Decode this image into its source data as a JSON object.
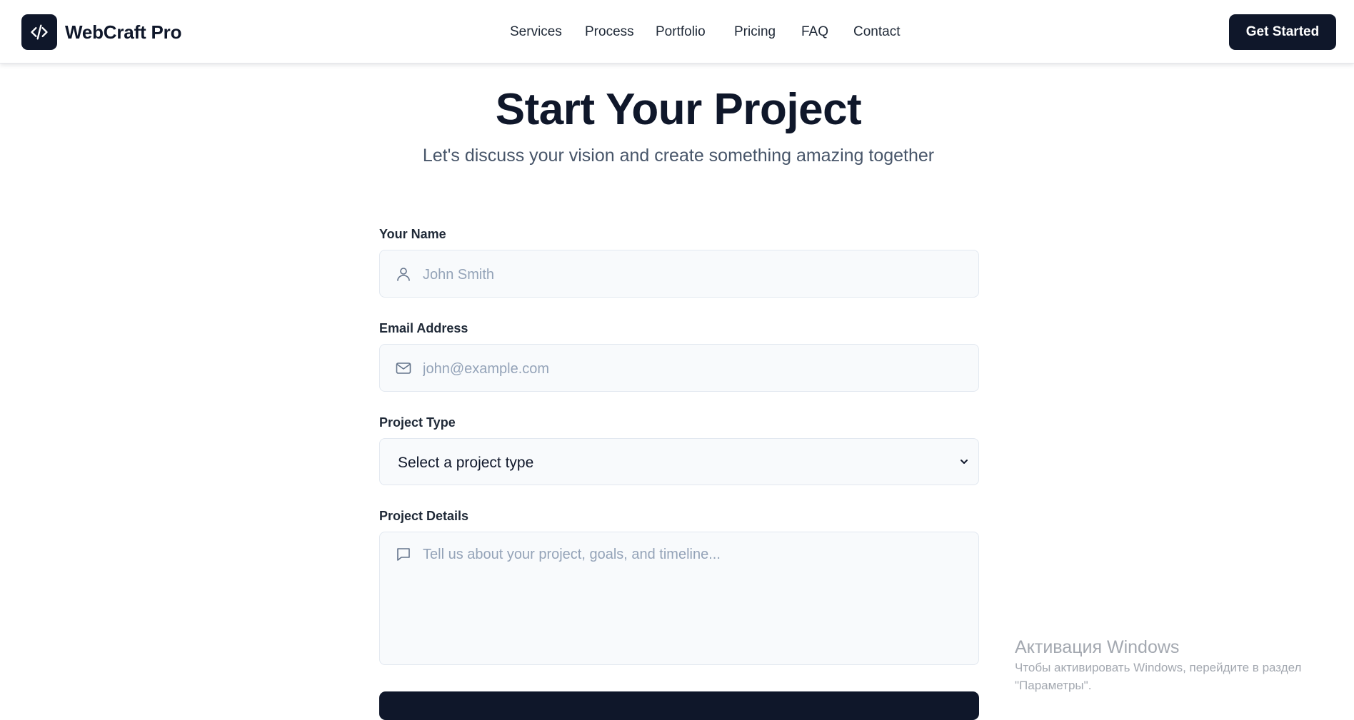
{
  "header": {
    "brand": "WebCraft Pro",
    "logo_icon": "code-icon",
    "nav": [
      "Services",
      "Process",
      "Portfolio",
      "Pricing",
      "FAQ",
      "Contact"
    ],
    "cta_label": "Get Started"
  },
  "hero": {
    "title": "Start Your Project",
    "subtitle": "Let's discuss your vision and create something amazing together"
  },
  "form": {
    "name": {
      "label": "Your Name",
      "placeholder": "John Smith",
      "icon": "user-icon"
    },
    "email": {
      "label": "Email Address",
      "placeholder": "john@example.com",
      "icon": "mail-icon"
    },
    "project_type": {
      "label": "Project Type",
      "selected": "Select a project type"
    },
    "details": {
      "label": "Project Details",
      "placeholder": "Tell us about your project, goals, and timeline...",
      "icon": "message-icon"
    }
  },
  "watermark": {
    "title": "Активация Windows",
    "line1": "Чтобы активировать Windows, перейдите в раздел",
    "line2": "\"Параметры\"."
  },
  "colors": {
    "primary": "#0f172a",
    "field_bg": "#f8fafc",
    "placeholder": "#94a3b8",
    "subtitle": "#475569"
  }
}
